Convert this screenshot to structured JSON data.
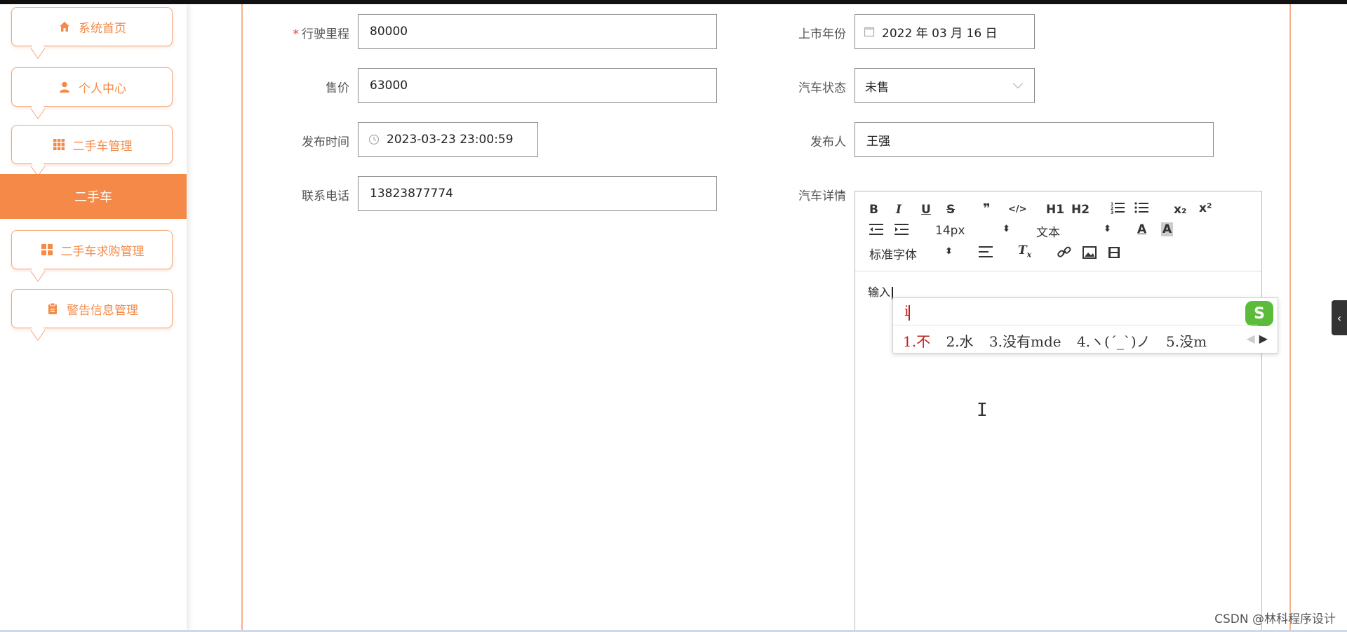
{
  "sidebar": {
    "items": [
      {
        "label": "系统首页",
        "icon": "home-icon"
      },
      {
        "label": "个人中心",
        "icon": "user-icon"
      },
      {
        "label": "二手车管理",
        "icon": "grid-icon"
      },
      {
        "label": "二手车求购管理",
        "icon": "apps-icon"
      },
      {
        "label": "警告信息管理",
        "icon": "clipboard-icon"
      }
    ],
    "active_sub": "二手车"
  },
  "form": {
    "mileage": {
      "label": "行驶里程",
      "required": "*",
      "value": "80000"
    },
    "year": {
      "label": "上市年份",
      "value": "2022 年 03 月 16 日"
    },
    "price": {
      "label": "售价",
      "value": "63000"
    },
    "status": {
      "label": "汽车状态",
      "value": "未售"
    },
    "publish_time": {
      "label": "发布时间",
      "value": "2023-03-23 23:00:59"
    },
    "publisher": {
      "label": "发布人",
      "value": "王强"
    },
    "phone": {
      "label": "联系电话",
      "value": "13823877774"
    },
    "details": {
      "label": "汽车详情"
    }
  },
  "editor": {
    "toolbar": {
      "bold": "B",
      "italic": "I",
      "underline": "U",
      "strike": "S",
      "quote": "❞",
      "code": "</>",
      "h1": "H1",
      "h2": "H2",
      "sub": "x₂",
      "sup": "x²",
      "size": "14px",
      "text": "文本",
      "font": "标准字体"
    },
    "content": "输入"
  },
  "ime": {
    "pinyin": "i",
    "candidates": [
      "1.不",
      "2.水",
      "3.没有mde",
      "4.ヽ(ˊ_ˋ)ノ",
      "5.没m"
    ],
    "logo": "S"
  },
  "watermark": "CSDN @林科程序设计"
}
